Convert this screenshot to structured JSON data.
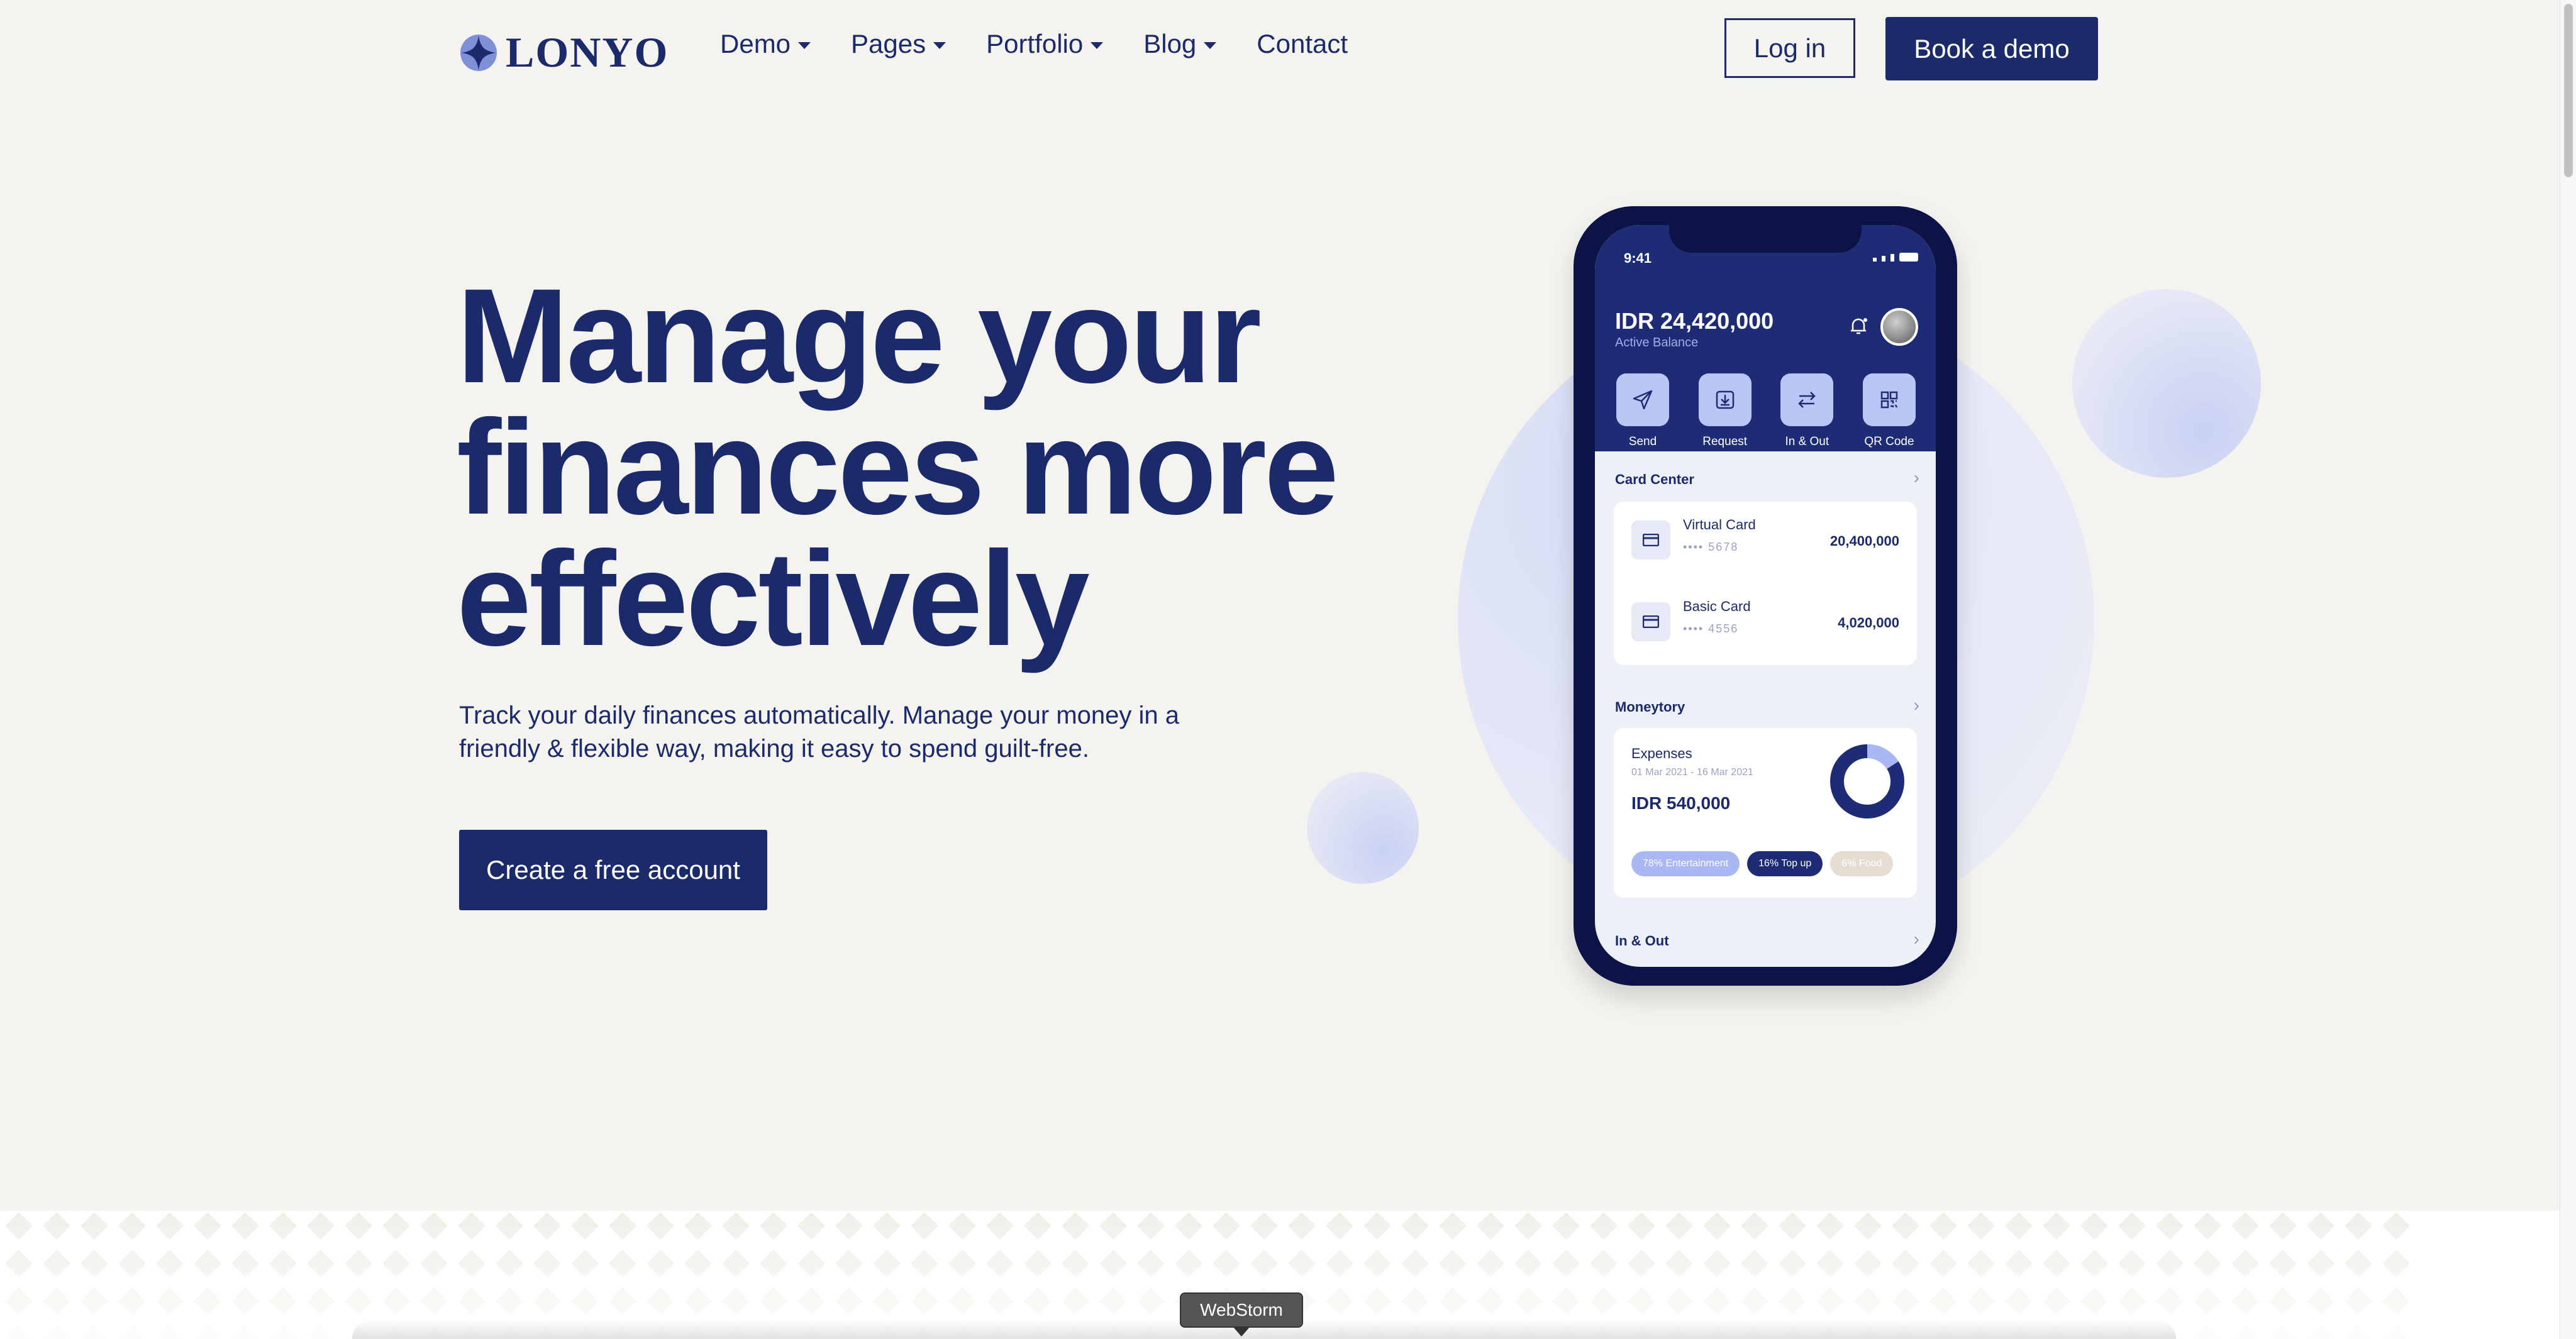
{
  "brand": {
    "name": "LONYO"
  },
  "nav": {
    "items": [
      {
        "label": "Demo",
        "dropdown": true
      },
      {
        "label": "Pages",
        "dropdown": true
      },
      {
        "label": "Portfolio",
        "dropdown": true
      },
      {
        "label": "Blog",
        "dropdown": true
      },
      {
        "label": "Contact",
        "dropdown": false
      }
    ],
    "login_label": "Log in",
    "demo_label": "Book a demo"
  },
  "hero": {
    "headline_lines": [
      "Manage your",
      "finances more",
      "effectively"
    ],
    "subtitle": "Track your daily finances automatically. Manage your money in a friendly & flexible way, making it easy to spend guilt-free.",
    "cta_label": "Create a free account"
  },
  "phone": {
    "time": "9:41",
    "balance": "IDR 24,420,000",
    "balance_label": "Active Balance",
    "actions": [
      {
        "label": "Send",
        "icon": "send-icon"
      },
      {
        "label": "Request",
        "icon": "request-icon"
      },
      {
        "label": "In & Out",
        "icon": "transfer-icon"
      },
      {
        "label": "QR Code",
        "icon": "qr-icon"
      }
    ],
    "card_center_title": "Card Center",
    "cards": [
      {
        "name": "Virtual Card",
        "number": "•••• 5678",
        "amount": "20,400,000"
      },
      {
        "name": "Basic Card",
        "number": "•••• 4556",
        "amount": "4,020,000"
      }
    ],
    "moneytory_title": "Moneytory",
    "expenses": {
      "label": "Expenses",
      "date_range": "01 Mar 2021 - 16 Mar 2021",
      "amount": "IDR 540,000",
      "pills": [
        {
          "label": "78% Entertainment",
          "bg": "#a9b8f3",
          "fg": "#ffffff"
        },
        {
          "label": "16% Top up",
          "bg": "#1d2c75",
          "fg": "#ffffff"
        },
        {
          "label": "6% Food",
          "bg": "#e4ddd0",
          "fg": "#ffffff"
        }
      ]
    },
    "in_out_title": "In & Out"
  },
  "tooltip": {
    "label": "WebStorm"
  },
  "colors": {
    "primary": "#1b2a6b",
    "background": "#f4f3ef",
    "accent_light": "#b9c6f5"
  }
}
